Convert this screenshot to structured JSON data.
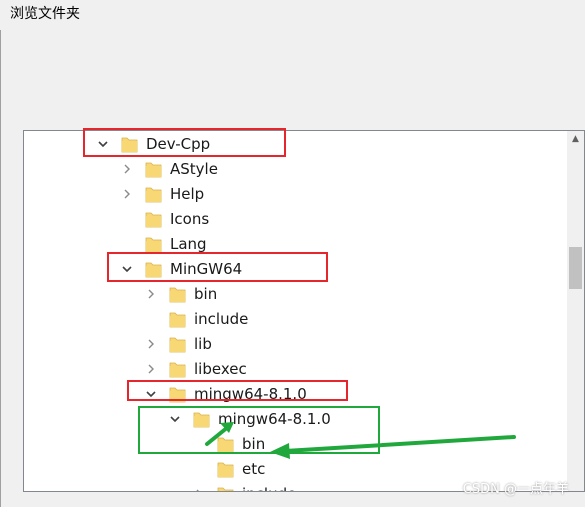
{
  "window": {
    "title": "浏览文件夹"
  },
  "tree": {
    "items": [
      {
        "label": "Dev-Cpp",
        "state": "expanded"
      },
      {
        "label": "AStyle",
        "state": "collapsed"
      },
      {
        "label": "Help",
        "state": "collapsed"
      },
      {
        "label": "Icons",
        "state": "none"
      },
      {
        "label": "Lang",
        "state": "none"
      },
      {
        "label": "MinGW64",
        "state": "expanded"
      },
      {
        "label": "bin",
        "state": "collapsed"
      },
      {
        "label": "include",
        "state": "none"
      },
      {
        "label": "lib",
        "state": "collapsed"
      },
      {
        "label": "libexec",
        "state": "collapsed"
      },
      {
        "label": "mingw64-8.1.0",
        "state": "expanded"
      },
      {
        "label": "mingw64-8.1.0",
        "state": "expanded"
      },
      {
        "label": "bin",
        "state": "none"
      },
      {
        "label": "etc",
        "state": "none"
      },
      {
        "label": "include",
        "state": "collapsed"
      }
    ]
  },
  "watermark": "CSDN @一点年羊",
  "colors": {
    "highlight_red": "#e5262c",
    "highlight_green": "#21a83d",
    "folder_yellow": "#f8d775"
  }
}
